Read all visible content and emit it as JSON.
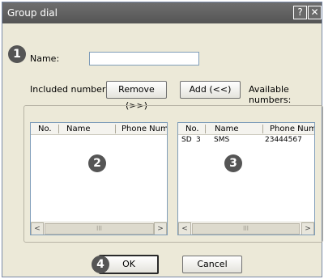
{
  "window": {
    "title": "Group dial",
    "help_glyph": "?",
    "close_glyph": "✕"
  },
  "form": {
    "name_label": "Name:",
    "name_value": "",
    "included_label": "Included numbers:",
    "available_label": "Available numbers:",
    "remove_button": "Remove (>>)",
    "add_button": "Add (<<)"
  },
  "included_list": {
    "columns": [
      "No.",
      "Name",
      "Phone Numbe"
    ],
    "rows": []
  },
  "available_list": {
    "columns": [
      "No.",
      "Name",
      "Phone Numb"
    ],
    "rows": [
      {
        "no_prefix": "SD",
        "no": "3",
        "name": "SMS",
        "phone": "23444567"
      }
    ]
  },
  "scrollbar": {
    "left_arrow": "<",
    "right_arrow": ">",
    "thumb_grip": "III"
  },
  "footer": {
    "ok_button": "OK",
    "cancel_button": "Cancel"
  },
  "markers": [
    "1",
    "2",
    "3",
    "4"
  ]
}
